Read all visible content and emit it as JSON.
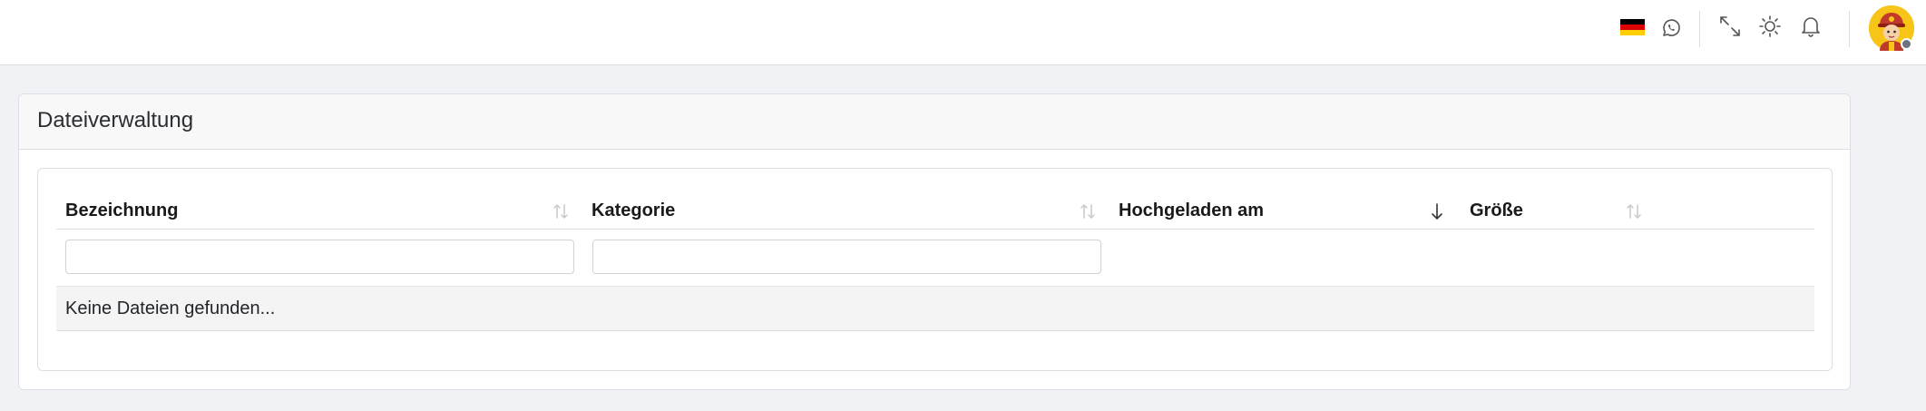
{
  "topbar": {
    "language_flag": {
      "name": "german-flag-icon",
      "colors": [
        "#000000",
        "#dd0000",
        "#ffce00"
      ]
    },
    "icons": [
      "whatsapp-icon",
      "fullscreen-icon",
      "theme-sun-icon",
      "bell-icon",
      "avatar"
    ],
    "avatar_status_color": "#6c757d"
  },
  "card": {
    "title": "Dateiverwaltung"
  },
  "table": {
    "columns": [
      {
        "label": "Bezeichnung",
        "sort": "none"
      },
      {
        "label": "Kategorie",
        "sort": "none"
      },
      {
        "label": "Hochgeladen am",
        "sort": "descending"
      },
      {
        "label": "Größe",
        "sort": "none"
      }
    ],
    "filters": [
      {
        "value": "",
        "placeholder": ""
      },
      {
        "value": "",
        "placeholder": ""
      }
    ],
    "empty_message": "Keine Dateien gefunden..."
  },
  "colors": {
    "page_background": "#f1f2f5",
    "border": "#dcdfe4",
    "header_background": "#f8f8f8",
    "empty_row_background": "#f4f4f4"
  }
}
